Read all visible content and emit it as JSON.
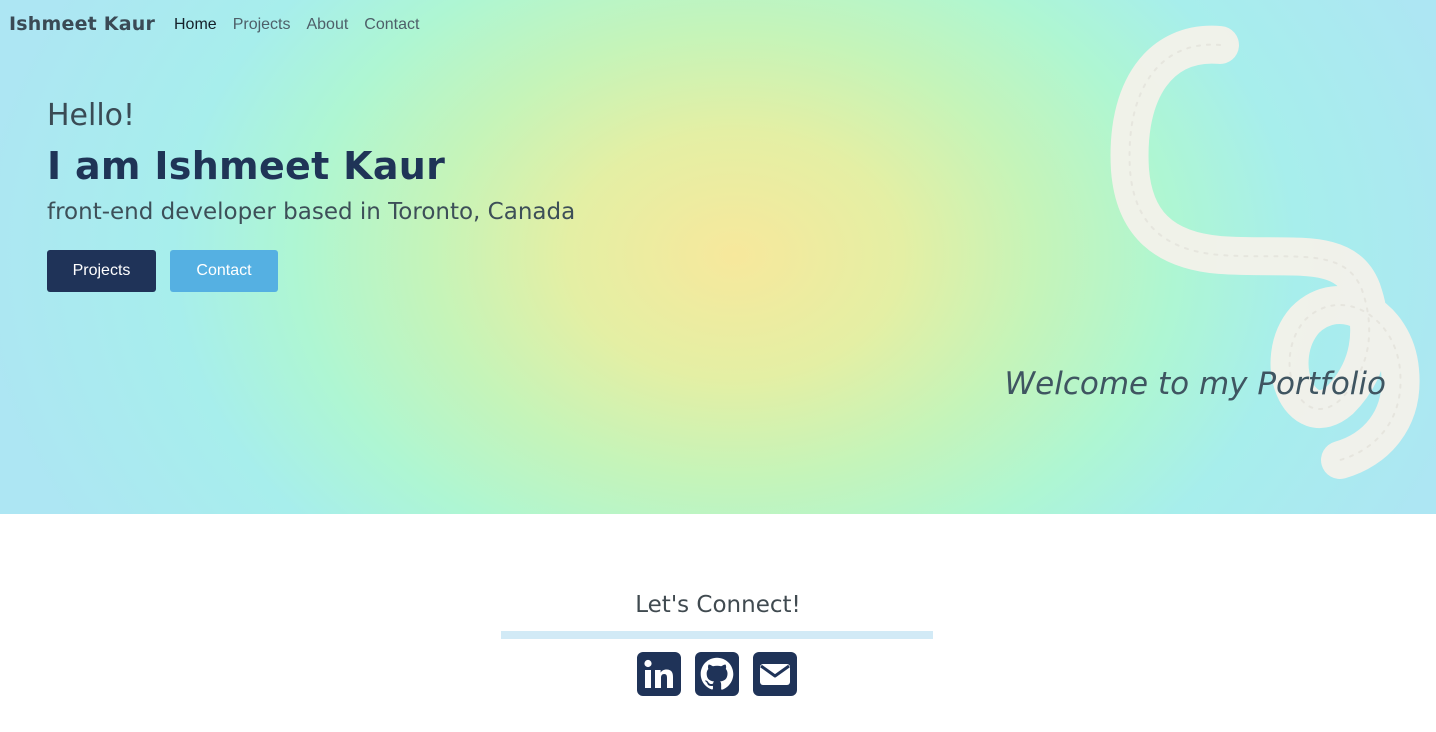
{
  "nav": {
    "brand": "Ishmeet Kaur",
    "links": [
      {
        "label": "Home"
      },
      {
        "label": "Projects"
      },
      {
        "label": "About"
      },
      {
        "label": "Contact"
      }
    ]
  },
  "hero": {
    "greeting": "Hello!",
    "name": "I am Ishmeet Kaur",
    "tagline": "front-end developer based in Toronto, Canada",
    "buttons": {
      "projects": "Projects",
      "contact": "Contact"
    },
    "welcome": "Welcome to my Portfolio"
  },
  "connect": {
    "title": "Let's Connect!",
    "social": [
      {
        "icon": "linkedin-icon"
      },
      {
        "icon": "github-icon"
      },
      {
        "icon": "envelope-icon"
      }
    ]
  },
  "colors": {
    "navy": "#1f3358",
    "sky": "#55b0e2",
    "gradient_center": "#f7e89c",
    "gradient_edge": "#ade6f3",
    "rule": "#d2eaf6"
  }
}
